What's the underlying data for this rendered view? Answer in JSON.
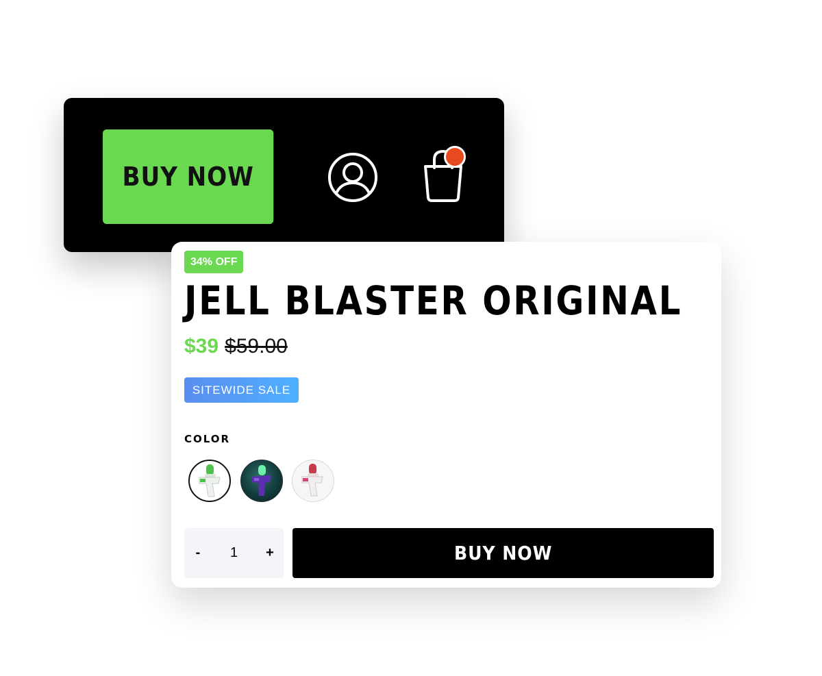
{
  "header": {
    "buy_now_label": "BUY NOW",
    "account_icon": "user-circle-icon",
    "cart_icon": "shopping-bag-icon",
    "cart_has_notification": true,
    "accent_color": "#6ad851",
    "notification_color": "#e84a1f"
  },
  "product": {
    "discount_badge": "34% OFF",
    "title": "JELL BLASTER ORIGINAL",
    "sale_price": "$39",
    "original_price": "$59.00",
    "sale_tag": "SITEWIDE SALE",
    "color_label": "COLOR",
    "colors": [
      {
        "swatch": "green-white-blaster",
        "selected": true
      },
      {
        "swatch": "purple-green-blaster",
        "selected": false
      },
      {
        "swatch": "red-white-blaster",
        "selected": false
      }
    ],
    "quantity": {
      "minus_label": "-",
      "value": "1",
      "plus_label": "+"
    },
    "buy_now_label": "BUY NOW",
    "colors_hex": {
      "accent_green": "#6ad851",
      "sale_tag_blue": "#4fa3ff",
      "button_black": "#000000"
    }
  }
}
